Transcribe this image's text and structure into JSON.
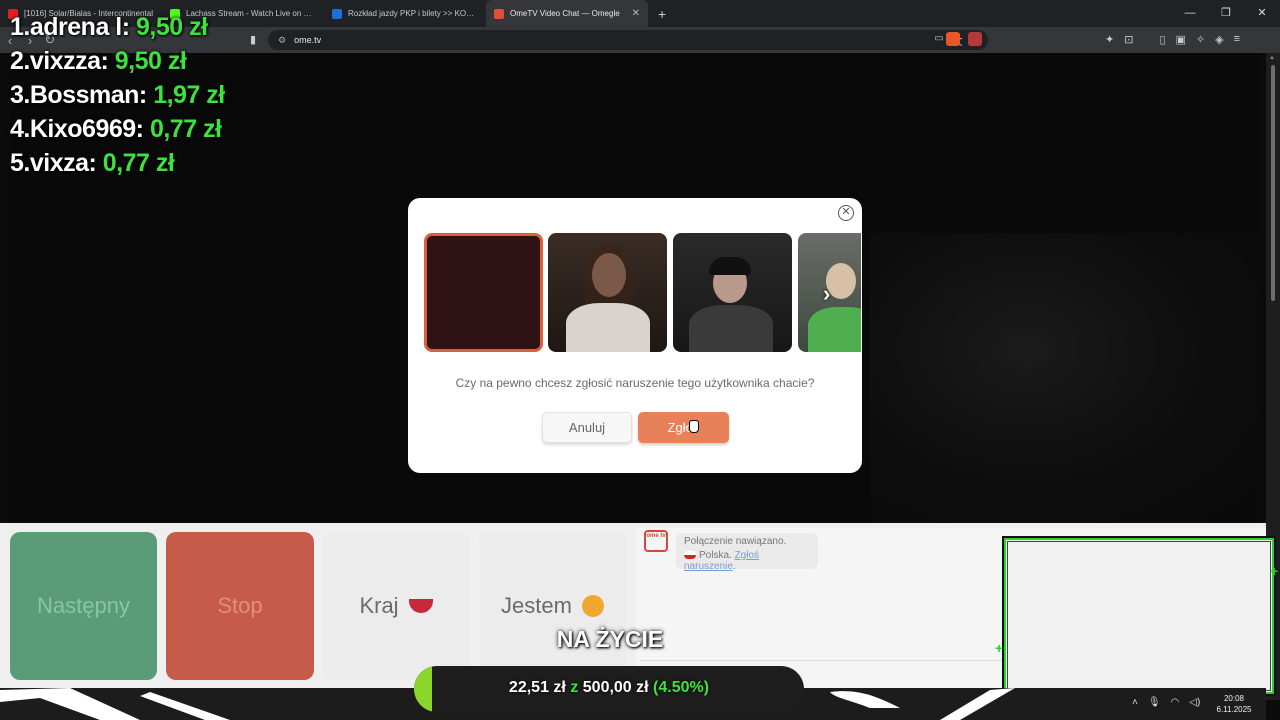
{
  "browser": {
    "tabs": [
      {
        "label": "[1016] Solar/Bialas - Intercontinental",
        "favicon_color": "#e02020"
      },
      {
        "label": "Lachass Stream - Watch Live on Kick",
        "favicon_color": "#53fc18"
      },
      {
        "label": "Rozkład jazdy PKP i bilety >> KOLEO",
        "favicon_color": "#1e6fd9"
      },
      {
        "label": "OmeTV Video Chat — Omegle",
        "favicon_color": "#e04e39"
      }
    ],
    "new_tab": "+",
    "address": "ome.tv",
    "window_controls": {
      "minimize": "—",
      "maximize": "❐",
      "close": "✕"
    }
  },
  "leaderboard": [
    {
      "rank": "1.",
      "name": "adrena l:",
      "amount": "9,50 zł"
    },
    {
      "rank": "2.",
      "name": "vixzza:",
      "amount": "9,50 zł"
    },
    {
      "rank": "3.",
      "name": "Bossman:",
      "amount": "1,97 zł"
    },
    {
      "rank": "4.",
      "name": "Kixo6969:",
      "amount": "0,77 zł"
    },
    {
      "rank": "5.",
      "name": "vixza:",
      "amount": "0,77 zł"
    }
  ],
  "modal": {
    "question": "Czy na pewno chcesz zgłosić naruszenie tego użytkownika chacie?",
    "cancel_label": "Anuluj",
    "report_label": "Zgłoś",
    "close_icon": "✕",
    "next_icon": "›"
  },
  "controls": {
    "next_label": "Następny",
    "stop_label": "Stop",
    "country_label": "Kraj",
    "gender_label": "Jestem"
  },
  "chat": {
    "logo_text": "ome tv",
    "line1": "Połączenie nawiązano.",
    "country": "Polska",
    "link": "Zgłoś naruszenie"
  },
  "goal": {
    "title": "NA ŻYCIE",
    "current": "22,51 zł",
    "separator": "z",
    "target": "500,00 zł",
    "percent_label": "(4.50%)",
    "progress": 0.045,
    "bar_color": "#8bd62a"
  },
  "taskbar": {
    "time": "20:08",
    "date": "6.11.2025"
  },
  "colors": {
    "accent_orange": "#e8805a",
    "leaderboard_green": "#3de23d",
    "next_green": "#5a9b78",
    "stop_red": "#c65b4a"
  }
}
